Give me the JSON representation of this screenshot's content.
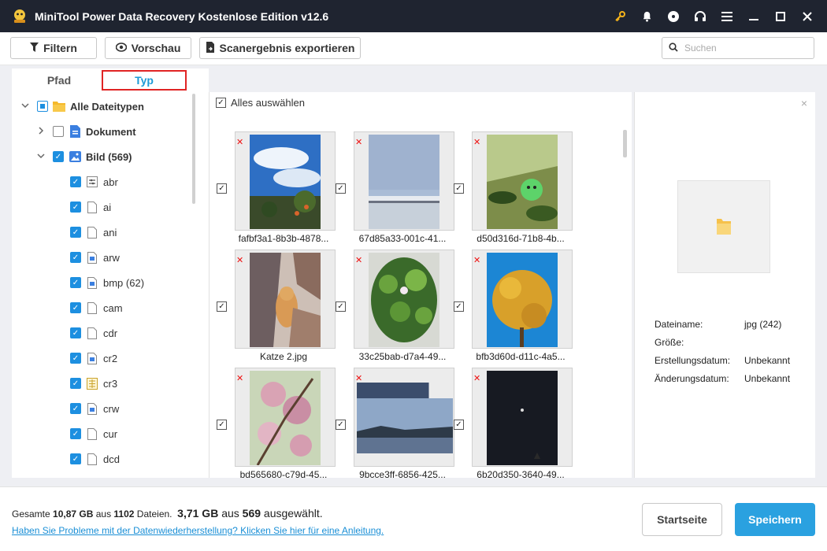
{
  "window": {
    "title": "MiniTool Power Data Recovery Kostenlose Edition v12.6",
    "icons": [
      "key-icon",
      "bell-icon",
      "disc-icon",
      "headset-icon",
      "menu-icon",
      "minimize-icon",
      "maximize-icon",
      "close-icon"
    ]
  },
  "toolbar": {
    "filter_label": "Filtern",
    "preview_label": "Vorschau",
    "export_label": "Scanergebnis exportieren",
    "search_placeholder": "Suchen"
  },
  "tabs": {
    "path_label": "Pfad",
    "type_label": "Typ"
  },
  "tree": {
    "items": [
      {
        "label": "Alle Dateitypen",
        "state": "partial",
        "expand": "open",
        "icon": "folder"
      },
      {
        "label": "Dokument",
        "state": "off",
        "expand": "closed",
        "icon": "doc"
      },
      {
        "label": "Bild (569)",
        "state": "on",
        "expand": "open",
        "icon": "image"
      },
      {
        "label": "abr",
        "state": "on",
        "icon": "filter-file"
      },
      {
        "label": "ai",
        "state": "on",
        "icon": "file"
      },
      {
        "label": "ani",
        "state": "on",
        "icon": "file"
      },
      {
        "label": "arw",
        "state": "on",
        "icon": "img-file"
      },
      {
        "label": "bmp (62)",
        "state": "on",
        "icon": "img-file"
      },
      {
        "label": "cam",
        "state": "on",
        "icon": "file"
      },
      {
        "label": "cdr",
        "state": "on",
        "icon": "file"
      },
      {
        "label": "cr2",
        "state": "on",
        "icon": "img-file"
      },
      {
        "label": "cr3",
        "state": "on",
        "icon": "grid-file"
      },
      {
        "label": "crw",
        "state": "on",
        "icon": "img-file"
      },
      {
        "label": "cur",
        "state": "on",
        "icon": "file"
      },
      {
        "label": "dcd",
        "state": "on",
        "icon": "file"
      }
    ]
  },
  "grid": {
    "select_all_label": "Alles auswählen",
    "thumbs": [
      {
        "caption": "fafbf3a1-8b3b-4878...",
        "scene": "sky-tree"
      },
      {
        "caption": "67d85a33-001c-41...",
        "scene": "snow-sky"
      },
      {
        "caption": "d50d316d-71b8-4b...",
        "scene": "leaves-ball"
      },
      {
        "caption": "Katze 2.jpg",
        "scene": "cat"
      },
      {
        "caption": "33c25bab-d7a4-49...",
        "scene": "pond"
      },
      {
        "caption": "bfb3d60d-d11c-4a5...",
        "scene": "yellow-tree"
      },
      {
        "caption": "bd565680-c79d-45...",
        "scene": "blossom"
      },
      {
        "caption": "9bcce3ff-6856-425...",
        "scene": "lake"
      },
      {
        "caption": "6b20d350-3640-49...",
        "scene": "night"
      }
    ]
  },
  "preview": {
    "close": "×",
    "rows": [
      {
        "key": "Dateiname:",
        "value": "jpg (242)"
      },
      {
        "key": "Größe:",
        "value": ""
      },
      {
        "key": "Erstellungsdatum:",
        "value": "Unbekannt"
      },
      {
        "key": "Änderungsdatum:",
        "value": "Unbekannt"
      }
    ]
  },
  "status": {
    "total_prefix": "Gesamte ",
    "total_size": "10,87 GB",
    "total_mid": " aus ",
    "total_files": "1102",
    "total_suffix": " Dateien.",
    "selected_size": "3,71 GB",
    "selected_mid": " aus ",
    "selected_count": "569",
    "selected_suffix": " ausgewählt.",
    "help_link": "Haben Sie Probleme mit der Datenwiederherstellung? Klicken Sie hier für eine Anleitung.",
    "home_button": "Startseite",
    "save_button": "Speichern"
  },
  "colors": {
    "titlebar": "#1f2430",
    "accent": "#1d9ad6",
    "save": "#2aa1e0",
    "highlight": "#e02424"
  }
}
